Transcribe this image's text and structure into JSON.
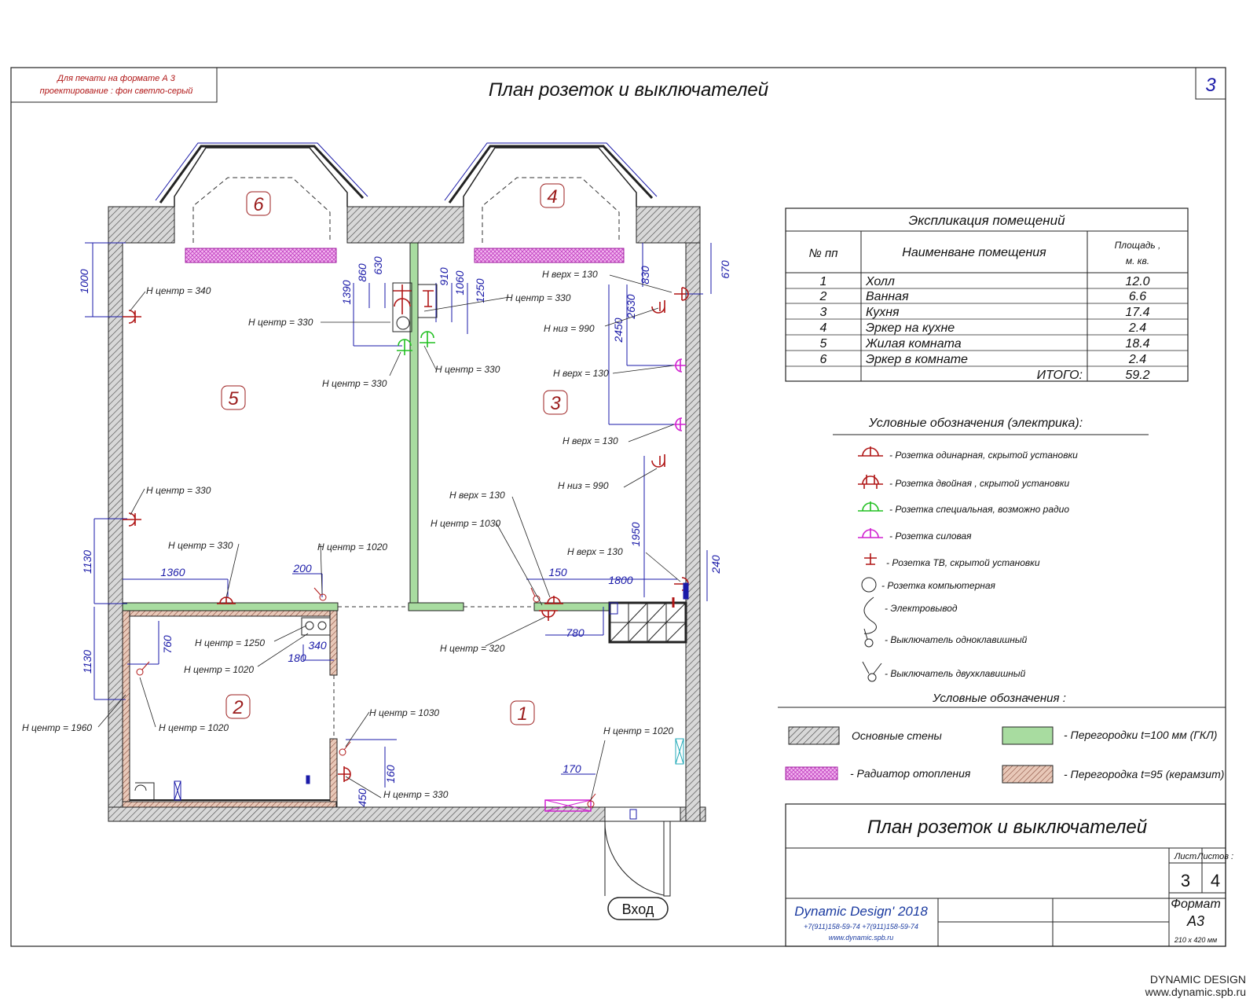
{
  "print_note": {
    "line1": "Для печати на формате А 3",
    "line2": "проектирование : фон светло-серый"
  },
  "title": "План  розеток и выключателей",
  "sheet_number": "3",
  "rooms": [
    {
      "num": "1"
    },
    {
      "num": "2"
    },
    {
      "num": "3"
    },
    {
      "num": "4"
    },
    {
      "num": "5"
    },
    {
      "num": "6"
    }
  ],
  "dimensions": [
    "1000",
    "1390",
    "860",
    "630",
    "910",
    "1060",
    "1250",
    "830",
    "670",
    "2630",
    "2450",
    "1950",
    "240",
    "1130",
    "1360",
    "200",
    "150",
    "1800",
    "780",
    "760",
    "1130",
    "340",
    "180",
    "160",
    "450",
    "170"
  ],
  "labels": [
    "Н центр = 340",
    "Н центр = 330",
    "Н центр = 330",
    "Н центр = 330",
    "Н центр = 330",
    "Н верх = 130",
    "Н низ = 990",
    "Н верх = 130",
    "Н верх = 130",
    "Н низ = 990",
    "Н верх = 130",
    "Н центр = 1030",
    "Н верх = 130",
    "Н центр = 330",
    "Н центр = 330",
    "Н центр = 1020",
    "Н центр = 1250",
    "Н центр = 1020",
    "Н центр = 320",
    "Н центр = 1960",
    "Н центр = 1020",
    "Н центр = 1030",
    "Н центр = 330",
    "Н центр = 1020"
  ],
  "entrance": "Вход",
  "explication": {
    "title": "Экспликация помещений",
    "headers": [
      "№ пп",
      "Наименване помещения",
      "Площадь ,",
      "м. кв."
    ],
    "rows": [
      {
        "n": "1",
        "name": "Холл",
        "area": "12.0"
      },
      {
        "n": "2",
        "name": "Ванная",
        "area": "6.6"
      },
      {
        "n": "3",
        "name": "Кухня",
        "area": "17.4"
      },
      {
        "n": "4",
        "name": "Эркер на кухне",
        "area": "2.4"
      },
      {
        "n": "5",
        "name": "Жилая комната",
        "area": "18.4"
      },
      {
        "n": "6",
        "name": "Эркер в комнате",
        "area": "2.4"
      }
    ],
    "total_label": "ИТОГО:",
    "total": "59.2"
  },
  "legend_electric": {
    "title": "Условные обозначения (электрика):",
    "items": [
      "- Розетка одинарная, скрытой установки",
      "- Розетка двойная , скрытой установки",
      "- Розетка специальная, возможно радио",
      "- Розетка силовая",
      "-  Розетка ТВ, скрытой установки",
      "- Розетка компьютерная",
      "-  Электровывод",
      "- Выключатель одноклавишный",
      "- Выключатель двухклавишный"
    ]
  },
  "legend_materials": {
    "title": "Условные обозначения :",
    "items": [
      "Основные стены",
      "- Перегородки  t=100 мм (ГКЛ)",
      "- Радиатор отопления",
      "- Перегородка  t=95 (керамзит)"
    ]
  },
  "stamp": {
    "title": "План  розеток и выключателей",
    "sheet_label": "Лист",
    "sheets_label": "Листов :",
    "sheet": "3",
    "sheets": "4",
    "format_label": "Формат",
    "format": "А3",
    "format_size": "210 х 420 мм",
    "company": "Dynamic Design' 2018",
    "phones": "+7(911)158-59-74      +7(911)158-59-74",
    "site": "www.dynamic.spb.ru"
  },
  "watermark": {
    "line1": "DYNAMIC DESIGN",
    "line2": "www.dynamic.spb.ru"
  },
  "colors": {
    "socket": "#b01515",
    "special": "#22c022",
    "power": "#d020d0",
    "dimension": "#1a1aa8",
    "partition_gkl": "#a8dca0",
    "radiator": "#e07ee0"
  }
}
